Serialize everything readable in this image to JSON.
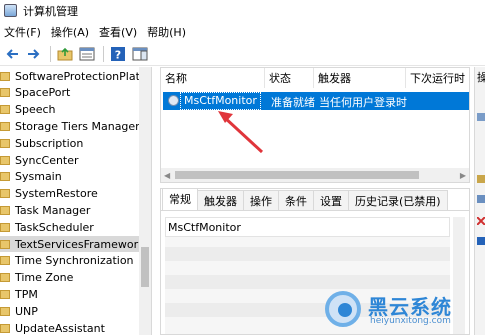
{
  "window": {
    "title": "计算机管理"
  },
  "menu": [
    "文件(F)",
    "操作(A)",
    "查看(V)",
    "帮助(H)"
  ],
  "toolbar": {
    "icons": [
      "back-arrow-icon",
      "forward-arrow-icon",
      "folder-up-icon",
      "properties-icon",
      "help-icon",
      "panel-icon"
    ]
  },
  "tree": {
    "items": [
      "SoftwareProtectionPlatform",
      "SpacePort",
      "Speech",
      "Storage Tiers Management",
      "Subscription",
      "SyncCenter",
      "Sysmain",
      "SystemRestore",
      "Task Manager",
      "TaskScheduler",
      "TextServicesFramework",
      "Time Synchronization",
      "Time Zone",
      "TPM",
      "UNP",
      "UpdateAssistant"
    ],
    "selected_index": 10
  },
  "task_list": {
    "columns": [
      "名称",
      "状态",
      "触发器",
      "下次运行时"
    ],
    "rows": [
      {
        "name": "MsCtfMonitor",
        "status": "准备就绪",
        "trigger": "当任何用户登录时"
      }
    ]
  },
  "details": {
    "tabs": [
      "常规",
      "触发器",
      "操作",
      "条件",
      "设置",
      "历史记录(已禁用)"
    ],
    "active_tab": 0,
    "task_name": "MsCtfMonitor"
  },
  "right_pane": {
    "header": "操"
  },
  "watermark": {
    "title": "黑云系统",
    "url": "heiyunxitong.com"
  },
  "colors": {
    "selection": "#0078d7",
    "annotation_arrow": "#e0353b",
    "watermark": "#2e86d6"
  }
}
